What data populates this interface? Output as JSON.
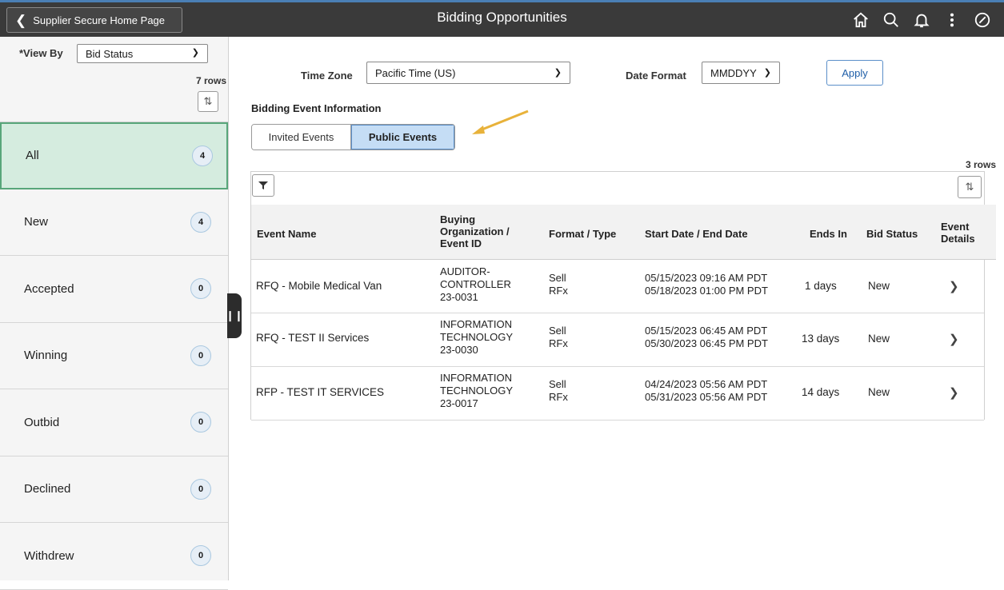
{
  "header": {
    "back_label": "Supplier Secure Home Page",
    "title": "Bidding Opportunities",
    "icons": [
      "home-icon",
      "search-icon",
      "bell-icon",
      "more-vertical-icon",
      "compass-icon"
    ]
  },
  "left": {
    "view_by_label": "*View By",
    "view_by_value": "Bid Status",
    "rows_label": "7 rows",
    "items": [
      {
        "label": "All",
        "count": "4"
      },
      {
        "label": "New",
        "count": "4"
      },
      {
        "label": "Accepted",
        "count": "0"
      },
      {
        "label": "Winning",
        "count": "0"
      },
      {
        "label": "Outbid",
        "count": "0"
      },
      {
        "label": "Declined",
        "count": "0"
      },
      {
        "label": "Withdrew",
        "count": "0"
      }
    ]
  },
  "filters": {
    "time_zone_label": "Time Zone",
    "time_zone_value": "Pacific Time (US)",
    "date_format_label": "Date Format",
    "date_format_value": "MMDDYY",
    "apply_label": "Apply"
  },
  "section_title": "Bidding Event Information",
  "tabs": {
    "invited": "Invited Events",
    "public": "Public Events"
  },
  "grid": {
    "rows_label": "3 rows",
    "headers": {
      "event_name": "Event Name",
      "buying_org": [
        "Buying",
        "Organization /",
        "Event ID"
      ],
      "format": "Format / Type",
      "dates": "Start Date / End Date",
      "ends_in": "Ends In",
      "bid_status": "Bid Status",
      "event_details": [
        "Event",
        "Details"
      ]
    },
    "rows": [
      {
        "name": "RFQ - Mobile Medical Van",
        "org1": "AUDITOR-",
        "org2": "CONTROLLER",
        "event_id": "23-0031",
        "format": "Sell",
        "type": "RFx",
        "start": "05/15/2023 09:16 AM PDT",
        "end": "05/18/2023 01:00 PM PDT",
        "ends_in": "1 days",
        "status": "New"
      },
      {
        "name": "RFQ - TEST II Services",
        "org1": "INFORMATION",
        "org2": "TECHNOLOGY",
        "event_id": "23-0030",
        "format": "Sell",
        "type": "RFx",
        "start": "05/15/2023 06:45 AM PDT",
        "end": "05/30/2023 06:45 PM PDT",
        "ends_in": "13 days",
        "status": "New"
      },
      {
        "name": "RFP - TEST IT SERVICES",
        "org1": "INFORMATION",
        "org2": "TECHNOLOGY",
        "event_id": "23-0017",
        "format": "Sell",
        "type": "RFx",
        "start": "04/24/2023 05:56 AM PDT",
        "end": "05/31/2023 05:56 AM PDT",
        "ends_in": "14 days",
        "status": "New"
      }
    ]
  },
  "colors": {
    "header_bg": "#3a3a3a",
    "active_item_bg": "#d5ecdf",
    "selected_tab_bg": "#c5ddf5",
    "arrow": "#e8b23a"
  }
}
